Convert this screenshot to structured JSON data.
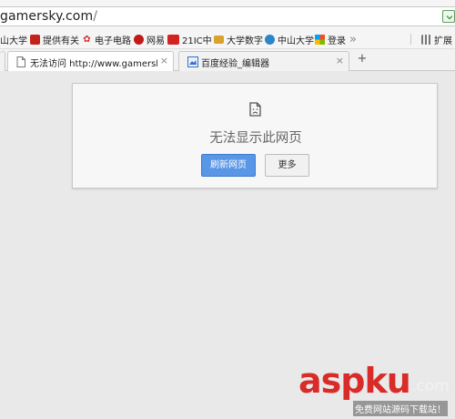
{
  "address_bar": {
    "url_host": "gamersky.com",
    "url_path": "/"
  },
  "bookmarks": [
    {
      "label": "山大学",
      "icon": "page-icon",
      "color": "#9e9e9e"
    },
    {
      "label": "提供有关",
      "icon": "bookmark-red-icon",
      "color": "#c2241d"
    },
    {
      "label": "电子电路",
      "icon": "red-leaf-icon",
      "color": "#d0312d"
    },
    {
      "label": "网易",
      "icon": "netease-icon",
      "color": "#c11a1a"
    },
    {
      "label": "21IC中",
      "icon": "21ic-icon",
      "color": "#d2231f"
    },
    {
      "label": "大学数字",
      "icon": "folder-icon",
      "color": "#d9a22a"
    },
    {
      "label": "中山大学",
      "icon": "globe-icon",
      "color": "#2a86c9"
    },
    {
      "label": "登录",
      "icon": "windows-icon",
      "color": "#3a7bd5"
    },
    {
      "label": "扩展",
      "icon": "grid-icon",
      "color": "#777777"
    }
  ],
  "more_bookmarks": "»",
  "tabs": [
    {
      "title": "无法访问 http://www.gamersky.con",
      "active": true,
      "close": "×"
    },
    {
      "title": "百度经验_编辑器",
      "active": false,
      "close": "×"
    }
  ],
  "new_tab": "+",
  "error_page": {
    "title": "无法显示此网页",
    "primary_button": "刷新网页",
    "secondary_button": "更多"
  },
  "watermark": {
    "brand": "aspku",
    "suffix": ".com",
    "subtitle": "免费网站源码下载站！"
  }
}
